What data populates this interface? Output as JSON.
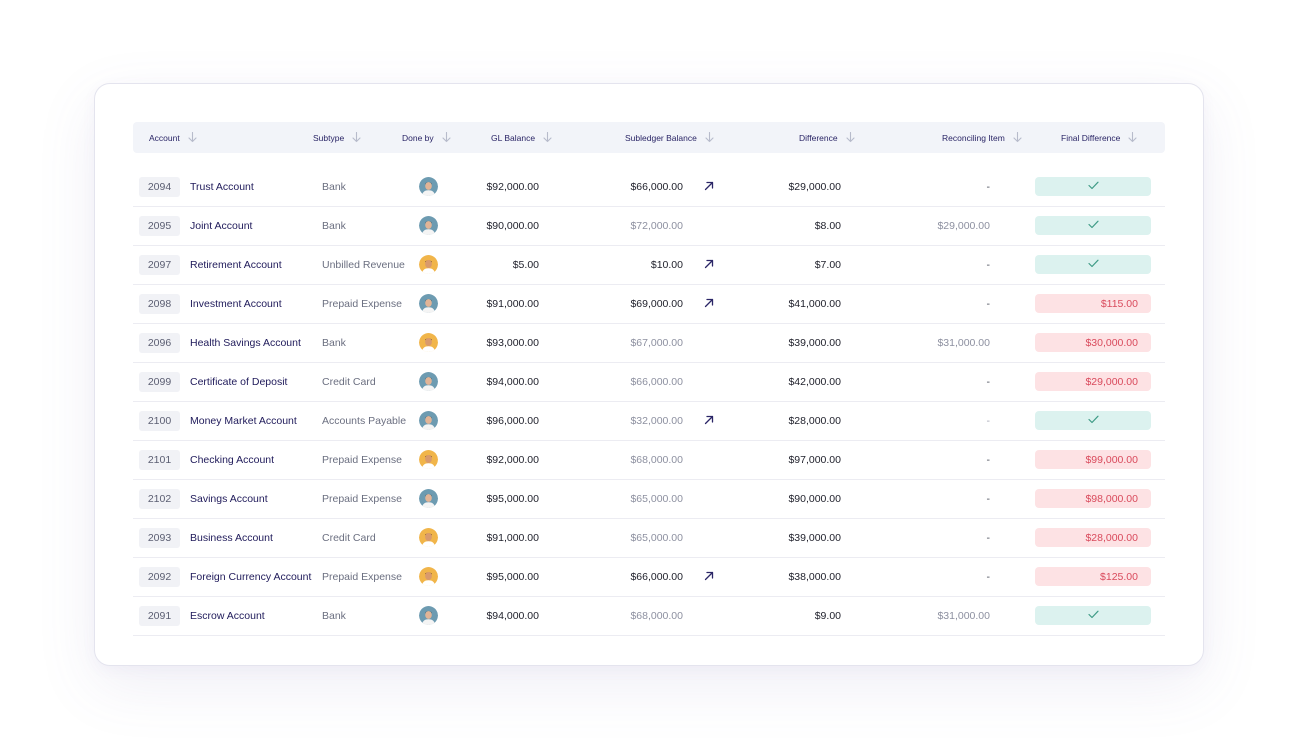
{
  "columns": {
    "account": "Account",
    "subtype": "Subtype",
    "done_by": "Done by",
    "gl_balance": "GL Balance",
    "subledger_balance": "Subledger Balance",
    "difference": "Difference",
    "reconciling_item": "Reconciling Item",
    "final_difference": "Final Difference"
  },
  "icons": {
    "sort": "arrow-down-icon",
    "link": "arrow-up-right-icon",
    "check": "check-icon"
  },
  "colors": {
    "ok_badge": "#dcf2ef",
    "bad_badge": "#fde2e4",
    "bad_text": "#d94a5c",
    "ok_check": "#3f9b86"
  },
  "rows": [
    {
      "id": "2094",
      "name": "Trust Account",
      "subtype": "Bank",
      "avatar": "a",
      "gl": "$92,000.00",
      "sub": "$66,000.00",
      "sub_muted": false,
      "arrow": true,
      "diff": "$29,000.00",
      "rec": "-",
      "final": "",
      "final_ok": true
    },
    {
      "id": "2095",
      "name": "Joint Account",
      "subtype": "Bank",
      "avatar": "a",
      "gl": "$90,000.00",
      "sub": "$72,000.00",
      "sub_muted": true,
      "arrow": false,
      "diff": "$8.00",
      "rec": "$29,000.00",
      "final": "",
      "final_ok": true
    },
    {
      "id": "2097",
      "name": "Retirement Account",
      "subtype": "Unbilled Revenue",
      "avatar": "b",
      "gl": "$5.00",
      "sub": "$10.00",
      "sub_muted": false,
      "arrow": true,
      "diff": "$7.00",
      "rec": "-",
      "final": "",
      "final_ok": true
    },
    {
      "id": "2098",
      "name": "Investment Account",
      "subtype": "Prepaid Expense",
      "avatar": "a",
      "gl": "$91,000.00",
      "sub": "$69,000.00",
      "sub_muted": false,
      "arrow": true,
      "diff": "$41,000.00",
      "rec": "-",
      "final": "$115.00",
      "final_ok": false
    },
    {
      "id": "2096",
      "name": "Health Savings Account",
      "subtype": "Bank",
      "avatar": "b",
      "gl": "$93,000.00",
      "sub": "$67,000.00",
      "sub_muted": true,
      "arrow": false,
      "diff": "$39,000.00",
      "rec": "$31,000.00",
      "final": "$30,000.00",
      "final_ok": false
    },
    {
      "id": "2099",
      "name": "Certificate of Deposit",
      "subtype": "Credit Card",
      "avatar": "a",
      "gl": "$94,000.00",
      "sub": "$66,000.00",
      "sub_muted": true,
      "arrow": false,
      "diff": "$42,000.00",
      "rec": "-",
      "final": "$29,000.00",
      "final_ok": false
    },
    {
      "id": "2100",
      "name": "Money Market Account",
      "subtype": "Accounts Payable",
      "avatar": "a",
      "gl": "$96,000.00",
      "sub": "$32,000.00",
      "sub_muted": true,
      "arrow": true,
      "diff": "$28,000.00",
      "rec": "-",
      "rec_light": true,
      "final": "",
      "final_ok": true
    },
    {
      "id": "2101",
      "name": "Checking Account",
      "subtype": "Prepaid Expense",
      "avatar": "b",
      "gl": "$92,000.00",
      "sub": "$68,000.00",
      "sub_muted": true,
      "arrow": false,
      "diff": "$97,000.00",
      "rec": "-",
      "final": "$99,000.00",
      "final_ok": false
    },
    {
      "id": "2102",
      "name": "Savings Account",
      "subtype": "Prepaid Expense",
      "avatar": "a",
      "gl": "$95,000.00",
      "sub": "$65,000.00",
      "sub_muted": true,
      "arrow": false,
      "diff": "$90,000.00",
      "rec": "-",
      "final": "$98,000.00",
      "final_ok": false
    },
    {
      "id": "2093",
      "name": "Business Account",
      "subtype": "Credit Card",
      "avatar": "b",
      "gl": "$91,000.00",
      "sub": "$65,000.00",
      "sub_muted": true,
      "arrow": false,
      "diff": "$39,000.00",
      "rec": "-",
      "final": "$28,000.00",
      "final_ok": false
    },
    {
      "id": "2092",
      "name": "Foreign Currency Account",
      "subtype": "Prepaid Expense",
      "avatar": "b",
      "gl": "$95,000.00",
      "sub": "$66,000.00",
      "sub_muted": false,
      "arrow": true,
      "diff": "$38,000.00",
      "rec": "-",
      "final": "$125.00",
      "final_ok": false
    },
    {
      "id": "2091",
      "name": "Escrow Account",
      "subtype": "Bank",
      "avatar": "a",
      "gl": "$94,000.00",
      "sub": "$68,000.00",
      "sub_muted": true,
      "arrow": false,
      "diff": "$9.00",
      "rec": "$31,000.00",
      "final": "",
      "final_ok": true
    }
  ]
}
